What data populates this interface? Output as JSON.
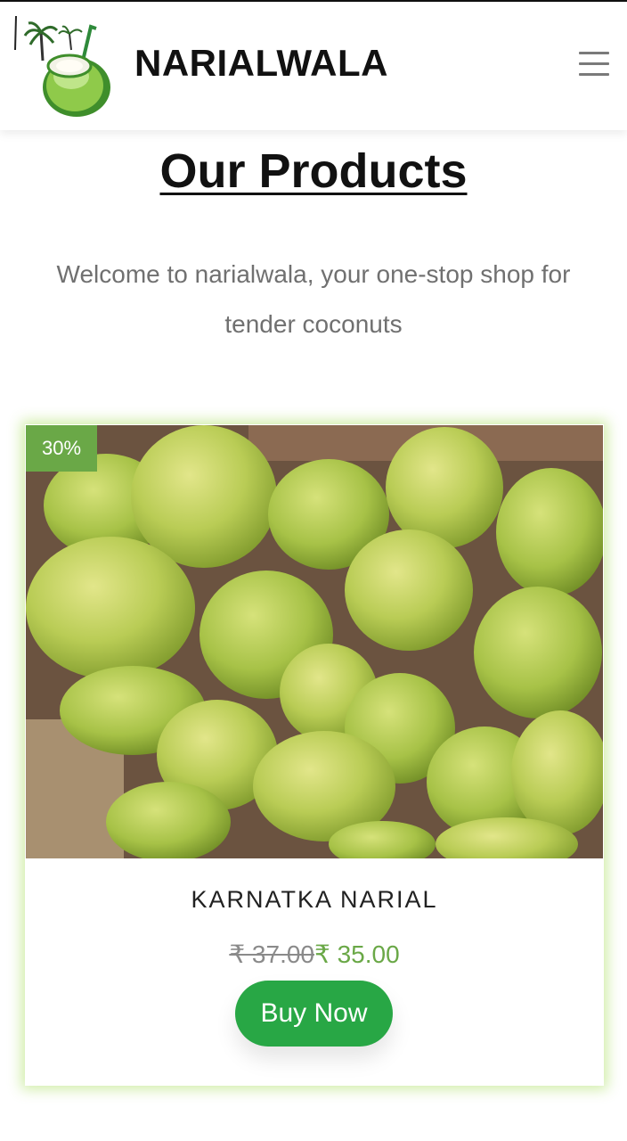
{
  "header": {
    "brand": "NARIALWALA",
    "logo_icon": "coconut-logo-icon",
    "menu_icon": "hamburger-menu-icon"
  },
  "main": {
    "title": "Our Products",
    "intro": "Welcome to narialwala, your one-stop shop for tender coconuts"
  },
  "product": {
    "discount_badge": "30%",
    "name": "KARNATKA NARIAL",
    "old_price": "₹ 37.00",
    "new_price": "₹ 35.00",
    "buy_label": "Buy Now",
    "image_subject": "pile of green tender coconuts"
  },
  "colors": {
    "accent_green": "#6aa847",
    "button_green": "#28a745",
    "card_glow": "#a6d95c"
  }
}
